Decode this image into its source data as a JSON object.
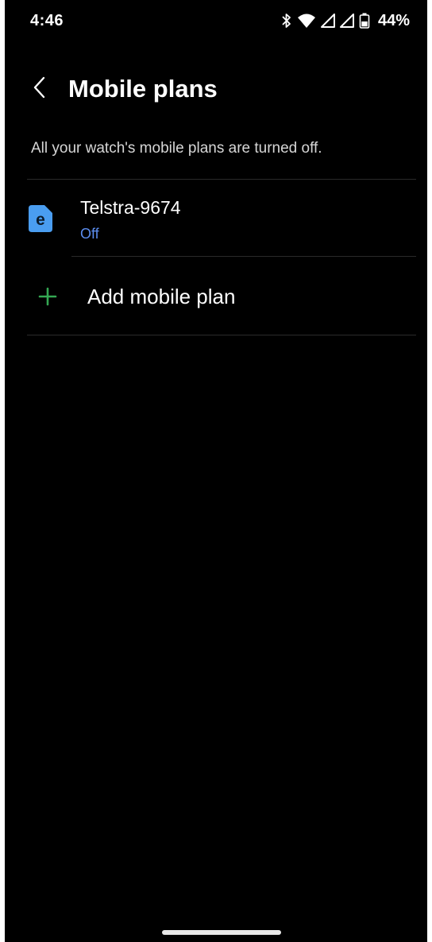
{
  "status_bar": {
    "time": "4:46",
    "battery": "44%",
    "icons": [
      "bluetooth-icon",
      "wifi-icon",
      "signal-icon",
      "signal-icon",
      "battery-icon"
    ]
  },
  "header": {
    "title": "Mobile plans",
    "back_icon": "chevron-left-icon"
  },
  "subtitle": "All your watch's mobile plans are turned off.",
  "plans": [
    {
      "name": "Telstra-9674",
      "status": "Off",
      "icon": "esim-icon",
      "icon_letter": "e",
      "icon_color": "#4a9df0",
      "status_color": "#5b8def"
    }
  ],
  "add_plan": {
    "label": "Add mobile plan",
    "icon": "plus-icon",
    "icon_color": "#34a853"
  },
  "colors": {
    "background": "#000000",
    "text": "#ffffff",
    "divider": "#2a2a2a"
  }
}
